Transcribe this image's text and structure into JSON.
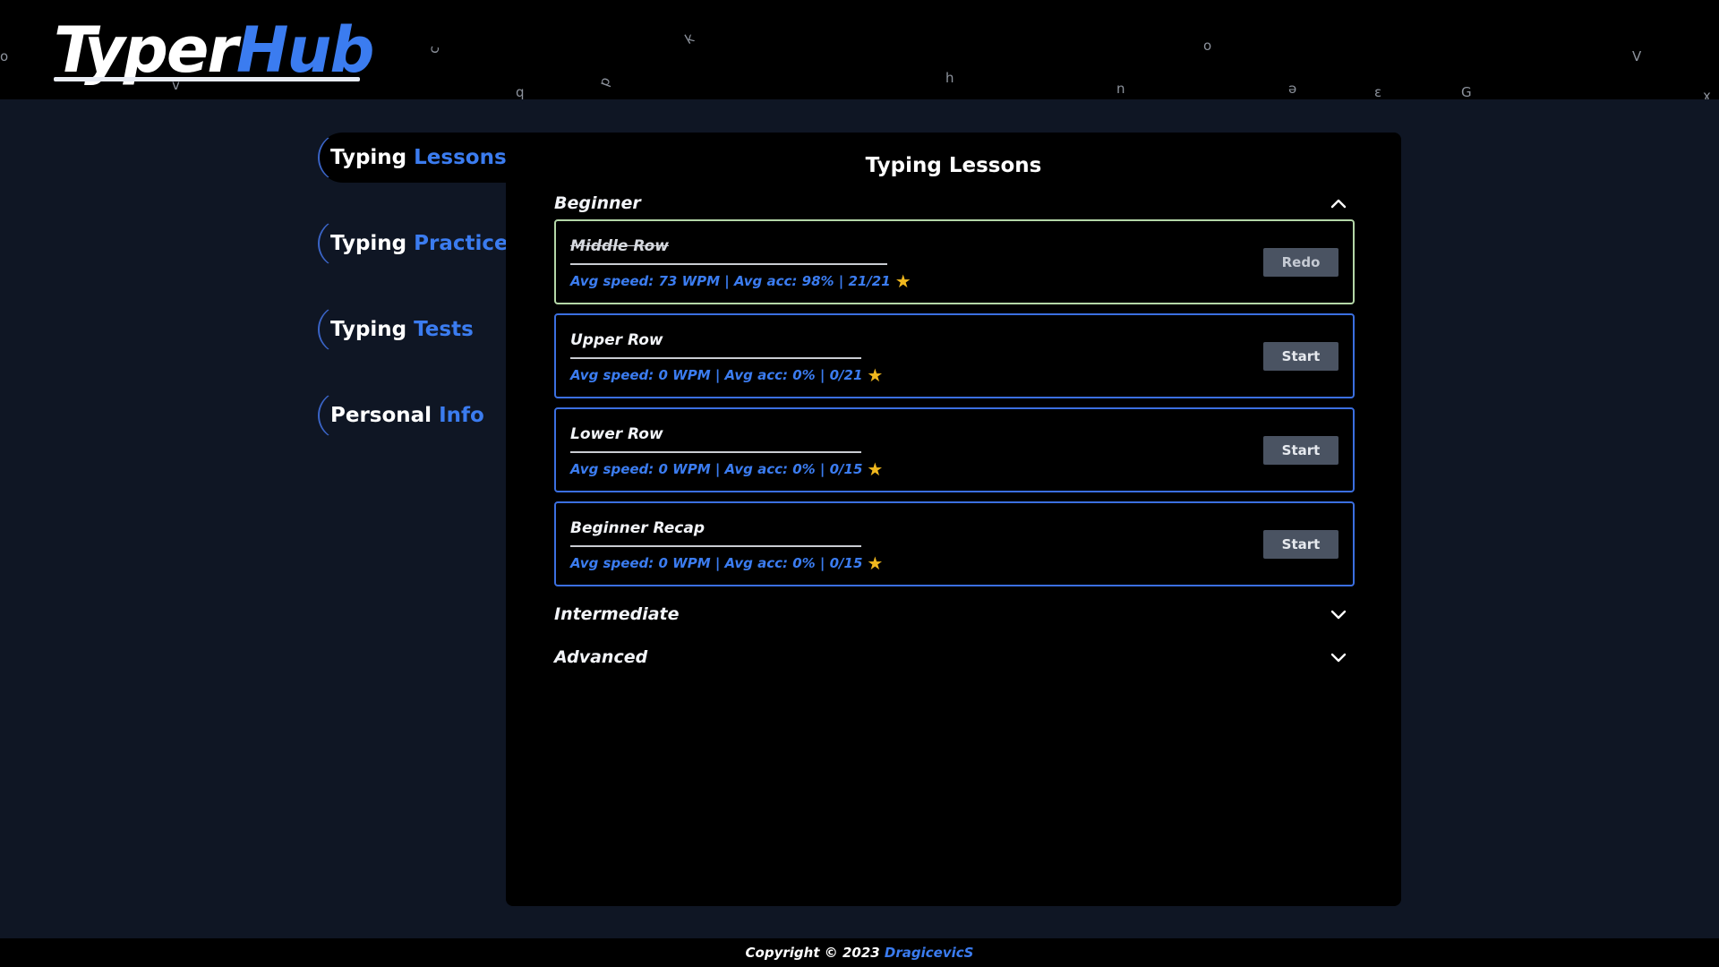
{
  "header": {
    "logo_part1": "Typer",
    "logo_part2": "Hub",
    "floating_letters": [
      "o",
      "c",
      "v",
      "k",
      "q",
      "p",
      "h",
      "o",
      "n",
      "ə",
      "ɛ",
      "G",
      "V",
      "ɤ"
    ]
  },
  "sidebar": {
    "items": [
      {
        "word1": "Typing",
        "word2": "Lessons",
        "active": true
      },
      {
        "word1": "Typing",
        "word2": "Practice",
        "active": false
      },
      {
        "word1": "Typing",
        "word2": "Tests",
        "active": false
      },
      {
        "word1": "Personal",
        "word2": "Info",
        "active": false
      }
    ]
  },
  "main": {
    "title": "Typing Lessons",
    "sections": [
      {
        "label": "Beginner",
        "expanded": true
      },
      {
        "label": "Intermediate",
        "expanded": false
      },
      {
        "label": "Advanced",
        "expanded": false
      }
    ],
    "lessons": [
      {
        "name": "Middle Row",
        "stats": "Avg speed: 73 WPM | Avg acc: 98% | 21/21",
        "button": "Redo",
        "completed": true
      },
      {
        "name": "Upper Row",
        "stats": "Avg speed: 0 WPM | Avg acc: 0% | 0/21",
        "button": "Start",
        "completed": false
      },
      {
        "name": "Lower Row",
        "stats": "Avg speed: 0 WPM | Avg acc: 0% | 0/15",
        "button": "Start",
        "completed": false
      },
      {
        "name": "Beginner Recap",
        "stats": "Avg speed: 0 WPM | Avg acc: 0% | 0/15",
        "button": "Start",
        "completed": false
      }
    ],
    "star_icon": "★"
  },
  "footer": {
    "text": "Copyright © 2023 ",
    "author": "DragicevicS"
  },
  "colors": {
    "accent": "#3b7cf0",
    "header_bg": "#000000",
    "page_bg": "#0f1624",
    "completed_border": "#b4d7a7",
    "lesson_border": "#3b6fe0",
    "star": "#f0b81e",
    "button_bg": "#4a5362"
  }
}
